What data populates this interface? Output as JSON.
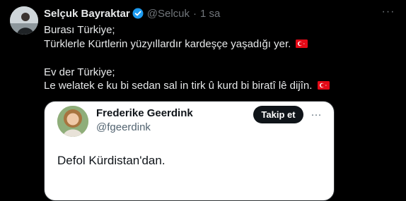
{
  "tweet": {
    "author_name": "Selçuk Bayraktar",
    "author_handle": "@Selcuk",
    "separator": "·",
    "time": "1 sa",
    "more_label": "···",
    "lines": [
      "Burası Türkiye;",
      "Türklerle Kürtlerin yüzyıllardır kardeşçe yaşadığı yer.",
      "Ev der Türkiye;",
      "Le welatek e ku bi sedan sal in tirk û kurd bi biratî lê dijîn."
    ],
    "flag_icon": "turkish-flag",
    "verified_color": "#1d9bf0"
  },
  "quoted_tweet": {
    "author_name": "Frederike Geerdink",
    "author_handle": "@fgeerdink",
    "follow_label": "Takip et",
    "more_label": "···",
    "text": "Defol Kürdistan'dan."
  },
  "colors": {
    "background": "#000000",
    "text_primary": "#e7e9ea",
    "text_secondary": "#71767b",
    "flag_red": "#e30a17"
  }
}
